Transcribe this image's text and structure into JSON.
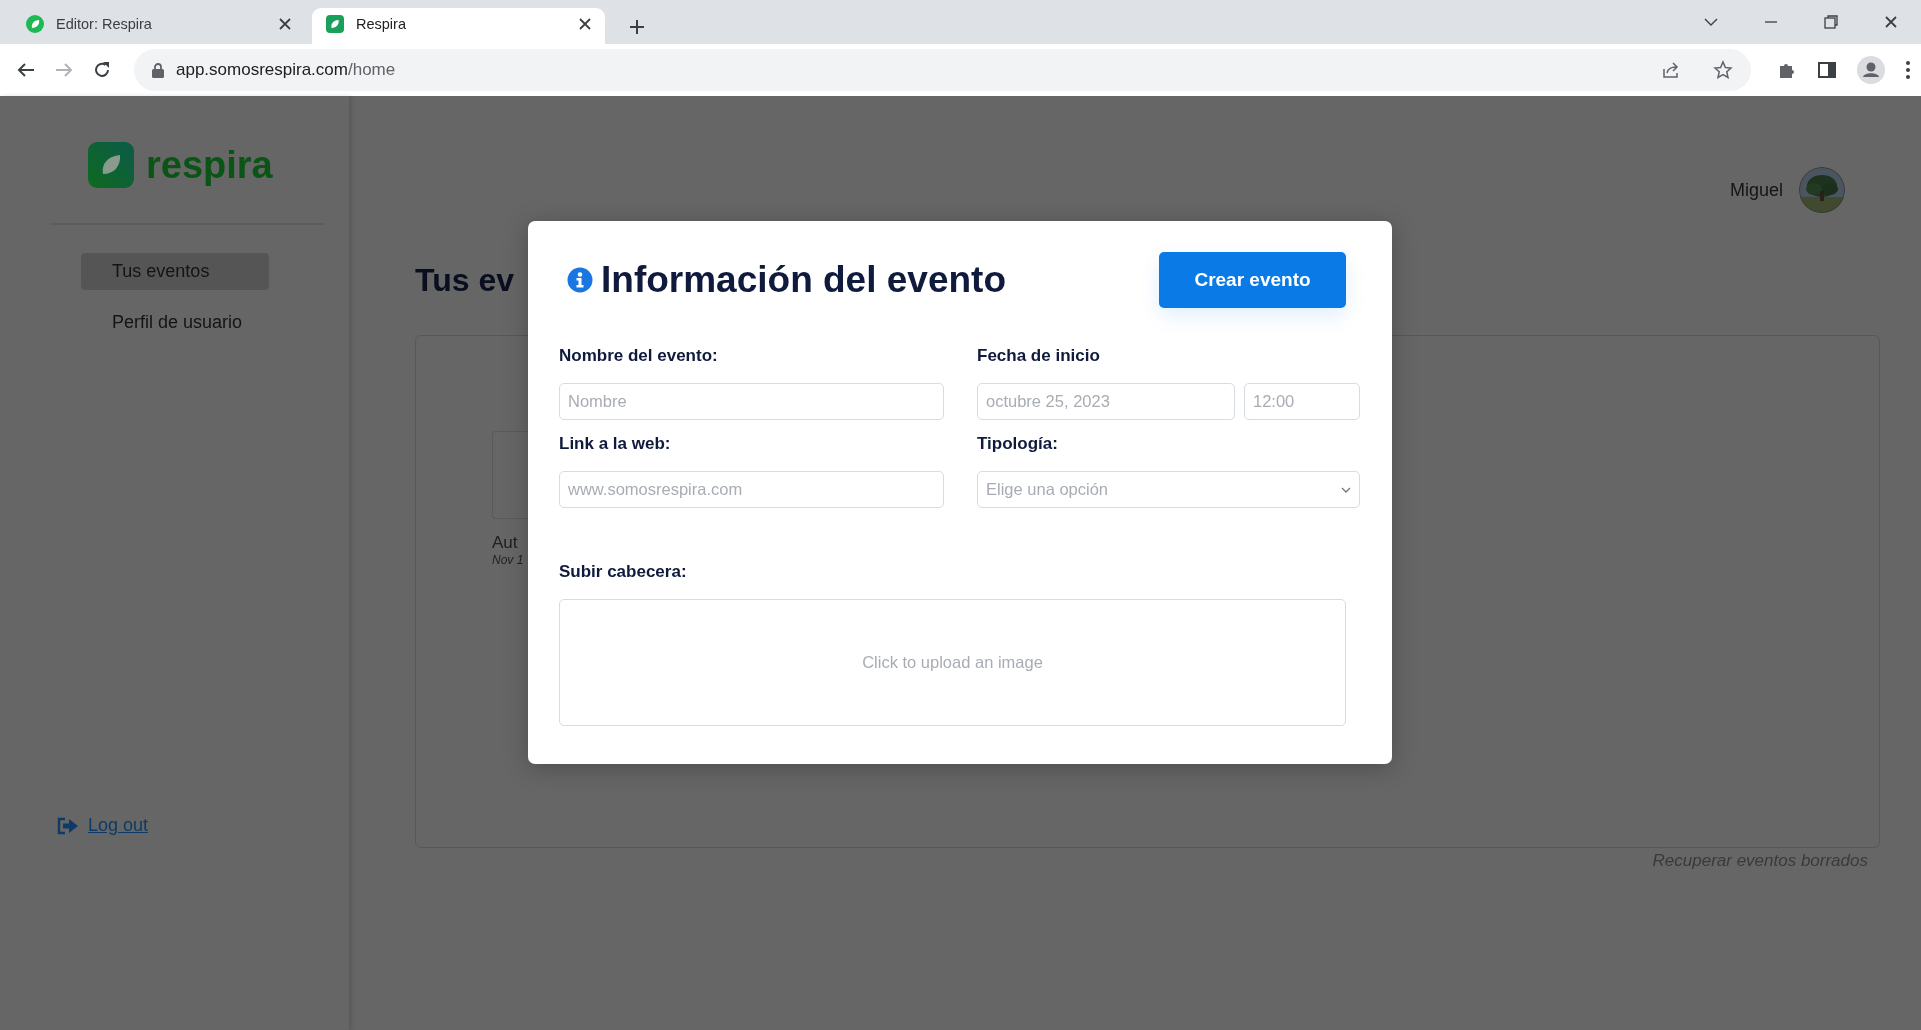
{
  "browser": {
    "tabs": [
      {
        "title": "Editor: Respira",
        "selected": false
      },
      {
        "title": "Respira",
        "selected": true
      }
    ],
    "url": {
      "domain": "app.somosrespira.com",
      "path": "/home"
    }
  },
  "sidebar": {
    "logo_text": "respira",
    "items": [
      {
        "label": "Tus eventos",
        "selected": true
      },
      {
        "label": "Perfil de usuario",
        "selected": false
      }
    ],
    "logout": "Log out"
  },
  "header": {
    "user_name": "Miguel"
  },
  "main": {
    "title": "Tus ev",
    "event_card": {
      "title": "Aut",
      "date": "Nov 1"
    },
    "recover_link": "Recuperar eventos borrados"
  },
  "modal": {
    "title": "Información del evento",
    "primary_button": "Crear evento",
    "fields": [
      {
        "kind": "text",
        "label": "Nombre del evento:",
        "placeholder": "Nombre"
      },
      {
        "kind": "datetime",
        "label": "Fecha de inicio",
        "placeholder": "octubre 25, 2023",
        "time_placeholder": "12:00"
      },
      {
        "kind": "text",
        "label": "Link a la web:",
        "placeholder": "www.somosrespira.com"
      },
      {
        "kind": "select",
        "label": "Tipología:",
        "placeholder": "Elige una opción"
      },
      {
        "kind": "upload",
        "label": "Subir cabecera:",
        "placeholder": "Click to upload an image"
      }
    ]
  }
}
